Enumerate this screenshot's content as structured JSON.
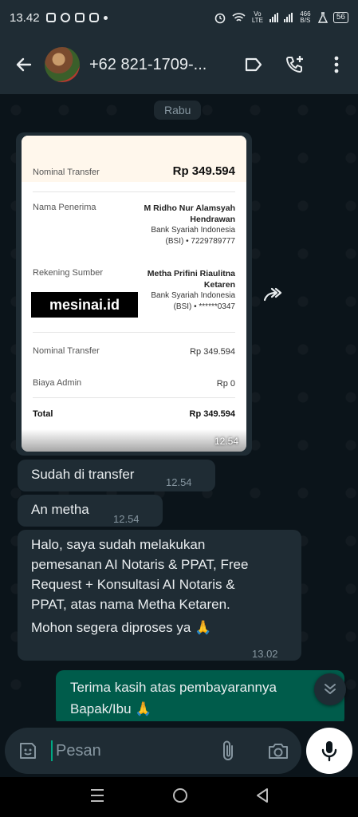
{
  "status_bar": {
    "time": "13.42",
    "network_label": "Vo LTE",
    "speed": "466 B/S",
    "battery": "56"
  },
  "header": {
    "contact_name": "+62 821-1709-..."
  },
  "chat": {
    "date_chip": "Rabu",
    "receipt": {
      "top_label": "Nominal Transfer",
      "top_amount": "Rp 349.594",
      "recipient_label": "Nama Penerima",
      "recipient_name_1": "M Ridho Nur Alamsyah",
      "recipient_name_2": "Hendrawan",
      "recipient_bank": "Bank Syariah Indonesia",
      "recipient_account": "(BSI) • 7229789777",
      "source_label": "Rekening Sumber",
      "source_name_1": "Metha Prifini Riaulitna",
      "source_name_2": "Ketaren",
      "source_bank": "Bank Syariah Indonesia",
      "source_account": "(BSI) • ******0347",
      "logo_text": "mesinai.id",
      "row1_label": "Nominal Transfer",
      "row1_value": "Rp 349.594",
      "row2_label": "Biaya Admin",
      "row2_value": "Rp 0",
      "total_label": "Total",
      "total_value": "Rp 349.594"
    },
    "image_time": "12.54",
    "messages": [
      {
        "text": "Sudah di transfer",
        "time": "12.54"
      },
      {
        "text": "An metha",
        "time": "12.54"
      },
      {
        "text_lines": [
          "Halo, saya sudah melakukan",
          "pemesanan AI Notaris & PPAT, Free",
          "Request + Konsultasi AI Notaris &",
          "PPAT, atas nama Metha Ketaren.",
          "Mohon segera diproses ya 🙏"
        ],
        "time": "13.02"
      },
      {
        "text_lines": [
          "Terima kasih atas pembayarannya",
          "Bapak/Ibu 🙏"
        ]
      }
    ]
  },
  "composer": {
    "placeholder": "Pesan"
  },
  "colors": {
    "background": "#0b141a",
    "bar": "#1f2c34",
    "incoming": "#1f2c34",
    "outgoing": "#005c4b",
    "accent": "#00a884"
  },
  "icons": [
    "back-arrow-icon",
    "label-icon",
    "add-call-icon",
    "more-vert-icon",
    "forward-icon",
    "emoji-icon",
    "attach-icon",
    "camera-icon",
    "mic-icon",
    "scroll-down-icon",
    "nav-recents-icon",
    "nav-home-icon",
    "nav-back-icon"
  ]
}
